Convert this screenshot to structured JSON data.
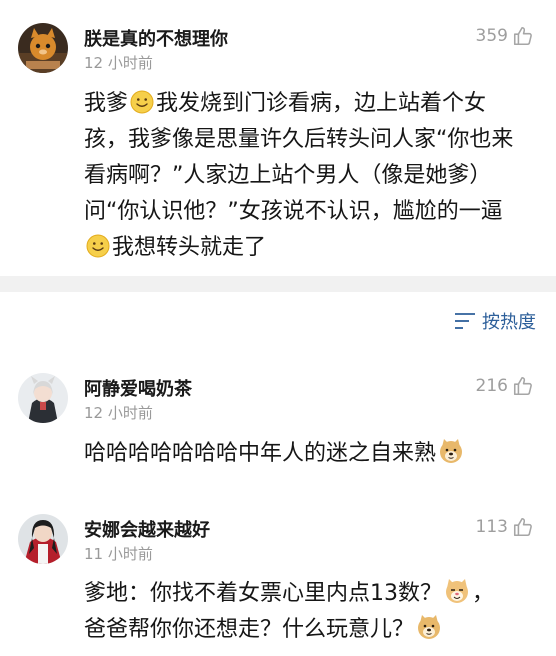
{
  "main_comment": {
    "username": "朕是真的不想理你",
    "timestamp": "12 小时前",
    "likes": "359",
    "text_parts": {
      "a": "我爹",
      "b": "我发烧到门诊看病，边上站着个女孩，我爹像是思量许久后转头问人家“你也来看病啊？”人家边上站个男人（像是她爹）问“你认识他？”女孩说不认识，尴尬的一逼",
      "c": "我想转头就走了"
    }
  },
  "sort": {
    "label": "按热度",
    "icon": "sort-lines-icon"
  },
  "replies": [
    {
      "username": "阿静爱喝奶茶",
      "timestamp": "12 小时前",
      "likes": "216",
      "text": "哈哈哈哈哈哈哈中年人的迷之自来熟",
      "emoji": "doge-icon"
    },
    {
      "username": "安娜会越来越好",
      "timestamp": "11 小时前",
      "likes": "113",
      "text_line1": "爹地：你找不着女票心里内点13数？",
      "text_line2": "爸爸帮你你还想走？什么玩意儿？",
      "emoji1": "cat-face-icon",
      "emoji2": "doge-icon"
    }
  ],
  "colors": {
    "divider": "#f1f1f1",
    "link_blue": "#2d5f9a",
    "meta_gray": "#9a9a9a"
  }
}
